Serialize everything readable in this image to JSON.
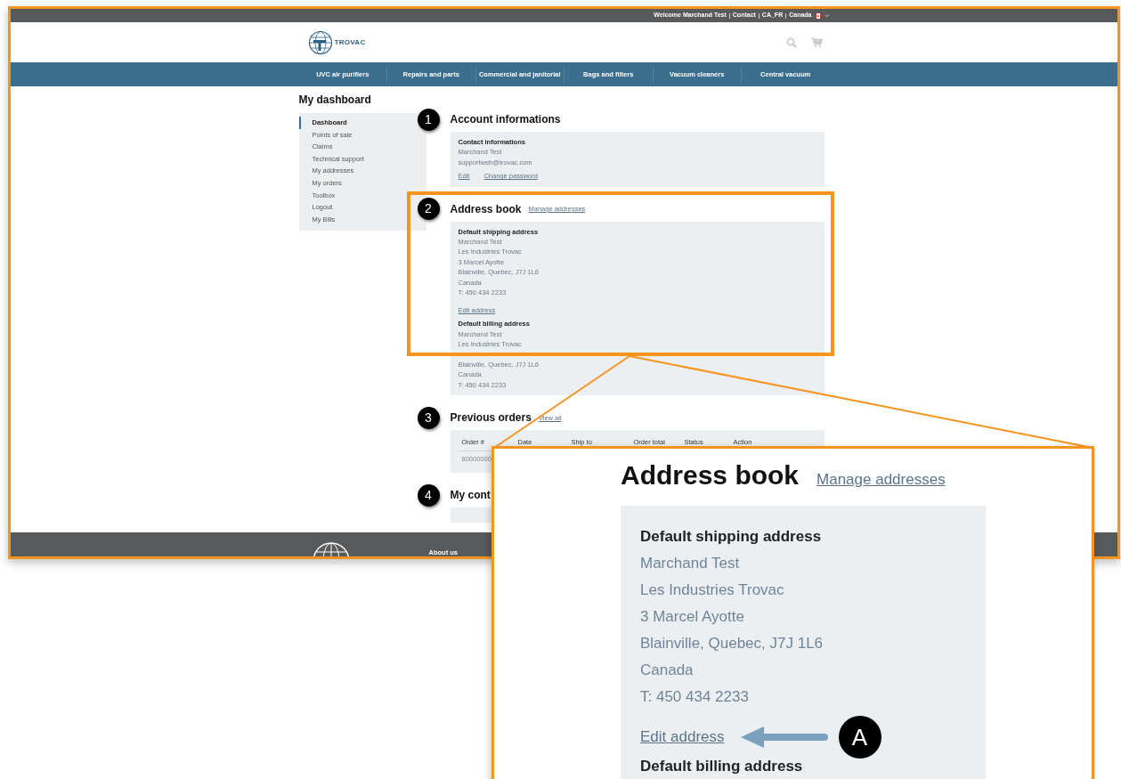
{
  "top_bar": {
    "links": [
      "Welcome Marchand Test",
      "Contact",
      "CA_FR",
      "Canada"
    ]
  },
  "logo": {
    "text": "TROVAC"
  },
  "nav": [
    "UVC air purifiers",
    "Repairs and parts",
    "Commercial and janitorial",
    "Bags and filters",
    "Vacuum cleaners",
    "Central vacuum"
  ],
  "page_title": "My dashboard",
  "sidebar": {
    "items": [
      {
        "label": "Dashboard",
        "selected": true
      },
      {
        "label": "Points of sale",
        "selected": false
      },
      {
        "label": "Claims",
        "selected": false
      },
      {
        "label": "Technical support",
        "selected": false
      },
      {
        "label": "My addresses",
        "selected": false
      },
      {
        "label": "My orders",
        "selected": false
      },
      {
        "label": "Toolbox",
        "selected": false
      },
      {
        "label": "Logout",
        "selected": false
      },
      {
        "label": "My Bills",
        "selected": false
      }
    ]
  },
  "account": {
    "marker": "1",
    "title": "Account informations",
    "card_title": "Contact informations",
    "lines": [
      "Marchand Test",
      "supportweb@trovac.com"
    ],
    "links": [
      "Edit",
      "Change password"
    ]
  },
  "address_book": {
    "marker": "2",
    "title": "Address book",
    "link": "Manage addresses",
    "shipping": {
      "title": "Default shipping address",
      "lines": [
        "Marchand Test",
        "Les Industries Trovac",
        "3 Marcel Ayotte",
        "Blainville, Quebec, J7J 1L6",
        "Canada",
        "T: 450 434 2233"
      ],
      "link": "Edit address"
    },
    "billing": {
      "title": "Default billing address",
      "lines_top": [
        "Marchand Test",
        "Les Industries Trovac"
      ],
      "lines_bottom": [
        "Blainville, Quebec, J7J 1L6",
        "Canada",
        "T: 450 434 2233"
      ]
    }
  },
  "orders": {
    "marker": "3",
    "title": "Previous orders",
    "link": "View all",
    "columns": [
      "Order #",
      "Date",
      "Ship to",
      "Order total",
      "Status",
      "Action"
    ],
    "rows": [
      [
        "80000000"
      ]
    ]
  },
  "contacts": {
    "marker": "4",
    "title": "My cont"
  },
  "footer": {
    "links": [
      "About us"
    ]
  },
  "zoom_inset": {
    "title": "Address book",
    "link": "Manage addresses",
    "card_title": "Default shipping address",
    "lines": [
      "Marchand Test",
      "Les Industries Trovac",
      "3 Marcel Ayotte",
      "Blainville, Quebec, J7J 1L6",
      "Canada",
      "T: 450 434 2233"
    ],
    "edit_link": "Edit address",
    "marker": "A",
    "next_title": "Default billing address"
  }
}
